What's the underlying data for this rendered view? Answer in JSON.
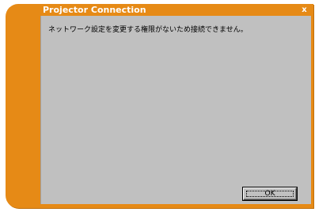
{
  "dialog": {
    "title": "Projector Connection",
    "close_icon": "close-icon",
    "close_glyph": "x",
    "message": "ネットワーク設定を変更する権限がないため接続できません。",
    "ok_label": "OK"
  },
  "colors": {
    "frame_accent": "#e68a16",
    "content_background": "#c0c0c0",
    "title_text": "#ffffff"
  }
}
